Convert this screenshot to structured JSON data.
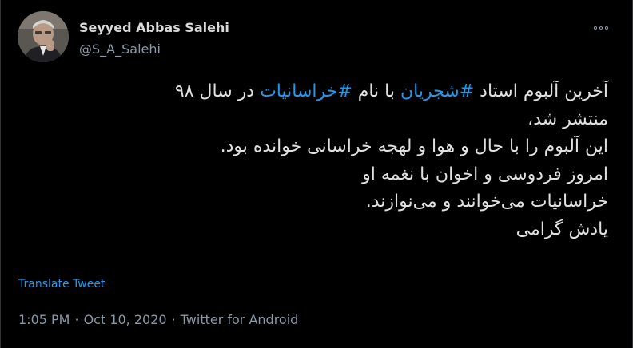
{
  "author": {
    "name": "Seyyed Abbas Salehi",
    "handle": "@S_A_Salehi"
  },
  "tweet": {
    "lines": [
      {
        "before": "آخرین آلبوم استاد ",
        "hashtag1": "#شجریان",
        "middle": " با نام ",
        "hashtag2": "#خراسانیات",
        "after": " در سال ۹۸"
      }
    ],
    "line2": "منتشر شد،",
    "line3": "این آلبوم را با حال و هوا و لهجه خراسانی خوانده بود.",
    "line4": "امروز فردوسی و اخوان با نغمه او",
    "line5": "خراسانیات می‌خوانند و می‌نوازند.",
    "line6": "یادش گرامی"
  },
  "translate_label": "Translate Tweet",
  "meta": {
    "time": "1:05 PM",
    "sep1": "·",
    "date": "Oct 10, 2020",
    "sep2": "·",
    "source": "Twitter for Android"
  },
  "icons": {
    "more": "more-horizontal-icon"
  }
}
